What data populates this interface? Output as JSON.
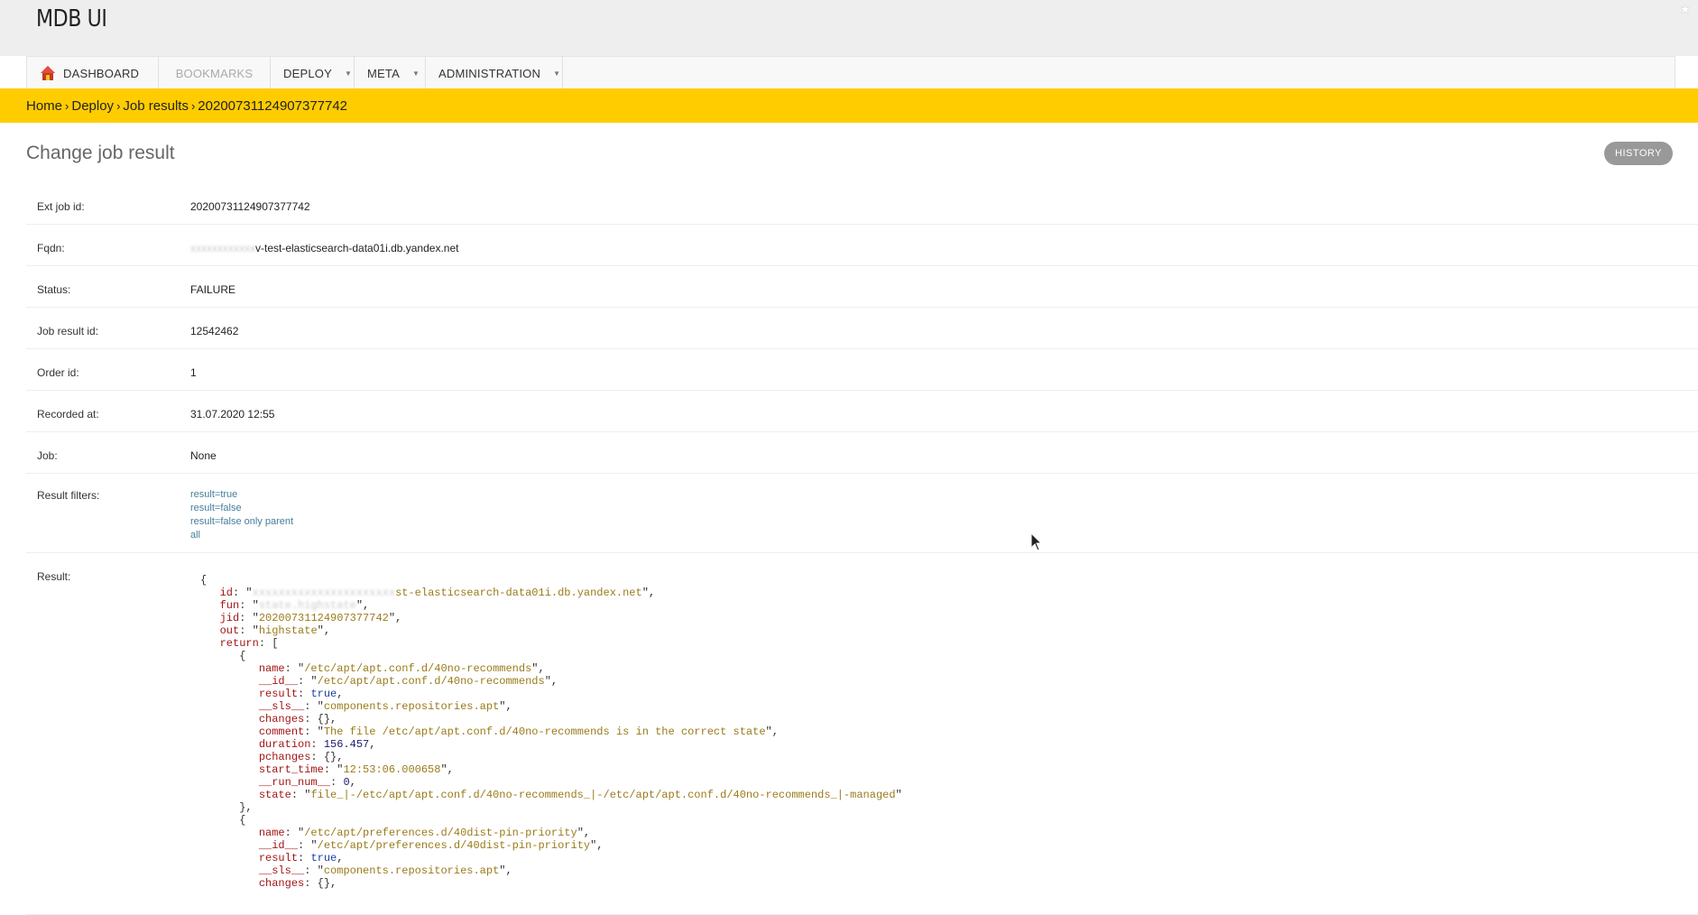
{
  "header": {
    "brand": "MDB UI"
  },
  "nav": {
    "dashboard": "DASHBOARD",
    "bookmarks": "BOOKMARKS",
    "deploy": "DEPLOY",
    "meta": "META",
    "administration": "ADMINISTRATION"
  },
  "breadcrumb": {
    "home": "Home",
    "deploy": "Deploy",
    "job_results": "Job results",
    "current": "20200731124907377742"
  },
  "page": {
    "title": "Change job result",
    "history_label": "HISTORY"
  },
  "fields": {
    "ext_job_id": {
      "label": "Ext job id:",
      "value": "20200731124907377742"
    },
    "fqdn": {
      "label": "Fqdn:",
      "value_hidden": "xxxxxxxxxxxx",
      "value": "v-test-elasticsearch-data01i.db.yandex.net"
    },
    "status": {
      "label": "Status:",
      "value": "FAILURE"
    },
    "job_result_id": {
      "label": "Job result id:",
      "value": "12542462"
    },
    "order_id": {
      "label": "Order id:",
      "value": "1"
    },
    "recorded_at": {
      "label": "Recorded at:",
      "value": "31.07.2020 12:55"
    },
    "job": {
      "label": "Job:",
      "value": "None"
    },
    "result_filters": {
      "label": "Result filters:",
      "links": [
        "result=true",
        "result=false",
        "result=false only parent",
        "all"
      ]
    },
    "result": {
      "label": "Result:"
    }
  },
  "result_json": {
    "id_hidden": "xxxxxxxxxxxxxxxxxxxxxx",
    "id_tail": "st-elasticsearch-data01i.db.yandex.net",
    "fun": "state.highstate",
    "jid": "20200731124907377742",
    "out": "highstate",
    "item1": {
      "name": "/etc/apt/apt.conf.d/40no-recommends",
      "id": "/etc/apt/apt.conf.d/40no-recommends",
      "result": "true",
      "sls": "components.repositories.apt",
      "changes": "{}",
      "comment": "The file /etc/apt/apt.conf.d/40no-recommends is in the correct state",
      "duration": "156.457",
      "pchanges": "{}",
      "start_time": "12:53:06.000658",
      "run_num": "0",
      "state": "file_|-/etc/apt/apt.conf.d/40no-recommends_|-/etc/apt/apt.conf.d/40no-recommends_|-managed"
    },
    "item2": {
      "name": "/etc/apt/preferences.d/40dist-pin-priority",
      "id": "/etc/apt/preferences.d/40dist-pin-priority",
      "result": "true",
      "sls": "components.repositories.apt",
      "changes": "{}"
    }
  }
}
